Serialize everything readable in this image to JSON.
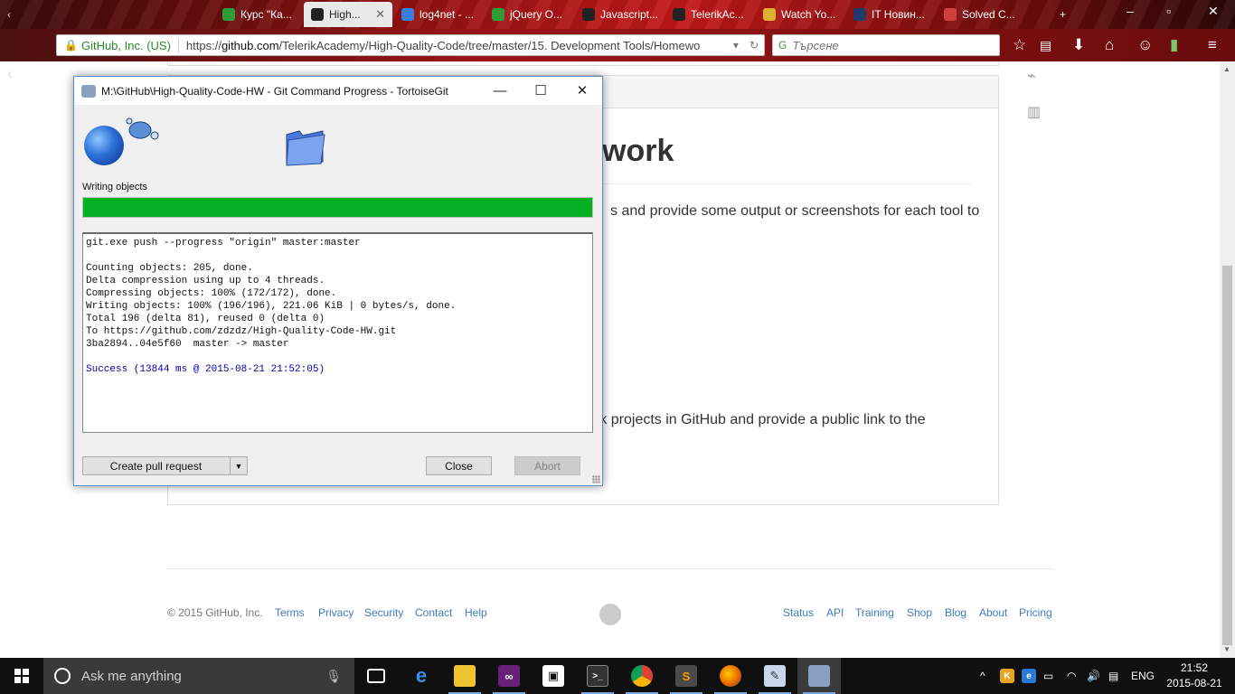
{
  "browser": {
    "tabs": [
      {
        "label": "Курс \"Ка...",
        "color": "#2e9b3a"
      },
      {
        "label": "High...",
        "color": "#222222",
        "active": true
      },
      {
        "label": "log4net - ...",
        "color": "#3b7de0"
      },
      {
        "label": "jQuery O...",
        "color": "#2e9b3a"
      },
      {
        "label": "Javascript...",
        "color": "#222222"
      },
      {
        "label": "TelerikAc...",
        "color": "#222222"
      },
      {
        "label": "Watch Yo...",
        "color": "#e0b030"
      },
      {
        "label": "IT Новин...",
        "color": "#1e3a6e"
      },
      {
        "label": "Solved C...",
        "color": "#d04040"
      }
    ],
    "new_tab_label": "+",
    "site_identity": "GitHub, Inc. (US)",
    "url_prefix": "https://",
    "url_host": "github.com",
    "url_path": "/TelerikAcademy/High-Quality-Code/tree/master/15. Development Tools/Homewo",
    "search_placeholder": "Търсене"
  },
  "page": {
    "heading": "work",
    "text_line_1": "s and provide some output or screenshots for each tool to",
    "text_line_2": "rk projects in GitHub and provide a public link to the",
    "footer": {
      "copyright": "© 2015 GitHub, Inc.",
      "left_links": [
        "Terms",
        "Privacy",
        "Security",
        "Contact",
        "Help"
      ],
      "right_links": [
        "Status",
        "API",
        "Training",
        "Shop",
        "Blog",
        "About",
        "Pricing"
      ]
    }
  },
  "dialog": {
    "title": "M:\\GitHub\\High-Quality-Code-HW - Git Command Progress - TortoiseGit",
    "status": "Writing objects",
    "progress": 1.0,
    "progress_color": "#06b025",
    "log": [
      "git.exe push --progress \"origin\" master:master",
      "",
      "Counting objects: 205, done.",
      "Delta compression using up to 4 threads.",
      "Compressing objects: 100% (172/172), done.",
      "Writing objects: 100% (196/196), 221.06 KiB | 0 bytes/s, done.",
      "Total 196 (delta 81), reused 0 (delta 0)",
      "To https://github.com/zdzdz/High-Quality-Code-HW.git",
      "3ba2894..04e5f60  master -> master",
      ""
    ],
    "success_line": "Success (13844 ms @ 2015-08-21 21:52:05)",
    "buttons": {
      "create_pull_request": "Create pull request",
      "close": "Close",
      "abort": "Abort"
    }
  },
  "taskbar": {
    "search_placeholder": "Ask me anything",
    "language": "ENG",
    "time": "21:52",
    "date": "2015-08-21"
  }
}
